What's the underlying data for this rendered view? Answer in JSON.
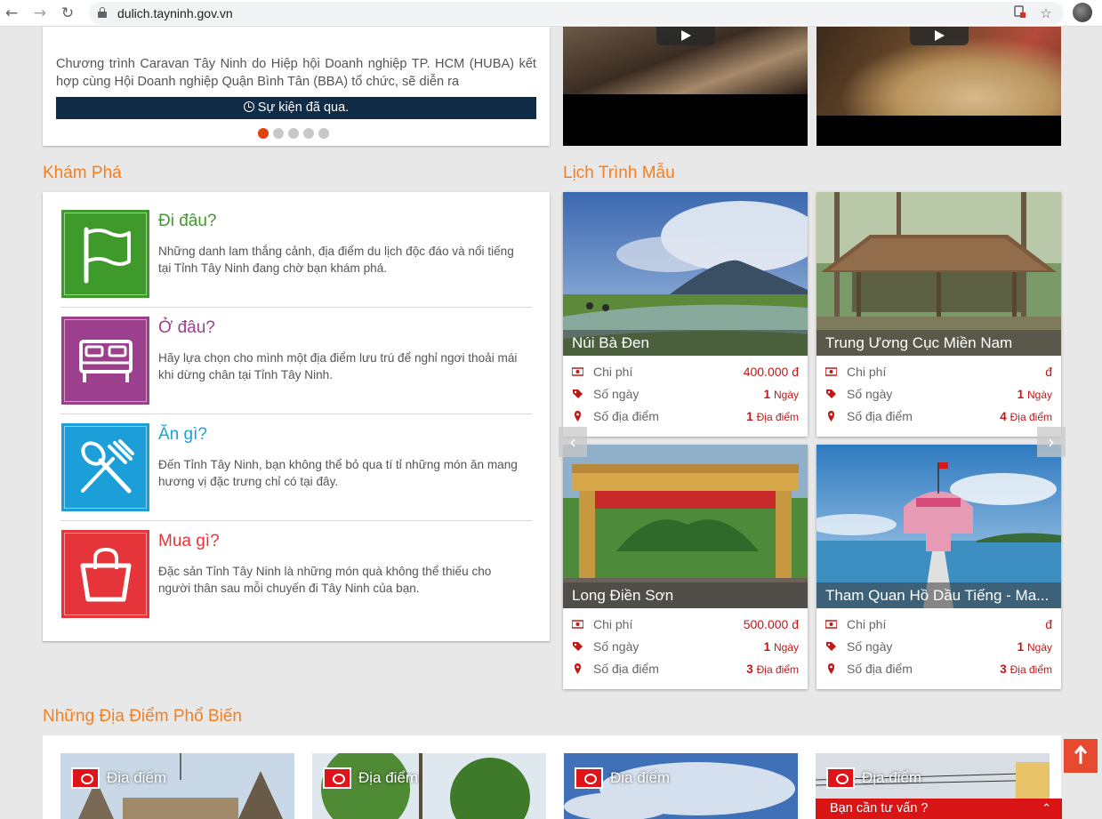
{
  "browser": {
    "url": "dulich.tayninh.gov.vn",
    "back_icon": "←",
    "forward_icon": "→",
    "reload_icon": "↻",
    "star_icon": "☆"
  },
  "event": {
    "description": "Chương trình Caravan Tây Ninh do Hiệp hội Doanh nghiệp TP. HCM (HUBA) kết hợp cùng Hội Doanh nghiệp Quận Bình Tân (BBA) tổ chức, sẽ diễn ra",
    "status": "Sự kiện đã qua.",
    "slide_count": 5,
    "active_slide": 1
  },
  "explore": {
    "title": "Khám Phá",
    "items": [
      {
        "title": "Đi đâu?",
        "desc": "Những danh lam thắng cảnh, địa điểm du lịch độc đáo và nổi tiếng tại Tỉnh Tây Ninh đang chờ bạn khám phá.",
        "color": "#3f9a2c",
        "icon": "flag-icon"
      },
      {
        "title": "Ở đâu?",
        "desc": "Hãy lựa chọn cho mình một địa điểm lưu trú để nghỉ ngơi thoải mái khi dừng chân tại Tỉnh Tây Ninh.",
        "color": "#9c3f8d",
        "icon": "bed-icon"
      },
      {
        "title": "Ăn gì?",
        "desc": "Đến Tỉnh Tây Ninh, bạn không thể bỏ qua tí tỉ những món ăn mang hương vị đặc trưng chỉ có tại đây.",
        "color": "#1c9fd8",
        "icon": "utensils-icon"
      },
      {
        "title": "Mua gì?",
        "desc": "Đặc sản Tỉnh Tây Ninh là những món quà không thể thiếu cho người thân sau mỗi chuyến đi Tây Ninh của bạn.",
        "color": "#e5353a",
        "icon": "shopping-bag-icon"
      }
    ]
  },
  "itinerary": {
    "title": "Lịch Trình Mẫu",
    "labels": {
      "cost": "Chi phí",
      "days": "Số ngày",
      "places": "Số địa điểm",
      "day_unit": "Ngày",
      "place_unit": "Địa điểm",
      "currency": "đ"
    },
    "tours": [
      {
        "name": "Núi Bà Đen",
        "cost": "400.000",
        "days": "1",
        "places": "1"
      },
      {
        "name": "Trung Ương Cục Miền Nam",
        "cost": "",
        "days": "1",
        "places": "4"
      },
      {
        "name": "Long Điền Sơn",
        "cost": "500.000",
        "days": "1",
        "places": "3"
      },
      {
        "name": "Tham Quan Hồ Dầu Tiếng - Ma...",
        "cost": "",
        "days": "1",
        "places": "3"
      }
    ],
    "prev_icon": "‹",
    "next_icon": "›"
  },
  "popular": {
    "title": "Những Địa Điểm Phổ Biến",
    "tag": "Địa điểm",
    "count": 4
  },
  "consult": {
    "label": "Bạn cần tư vấn ?",
    "chevron": "⌃"
  },
  "colors": {
    "accent": "#f47f20",
    "event_bar": "#0f2b46",
    "price": "#c01818",
    "consult": "#d91414"
  }
}
